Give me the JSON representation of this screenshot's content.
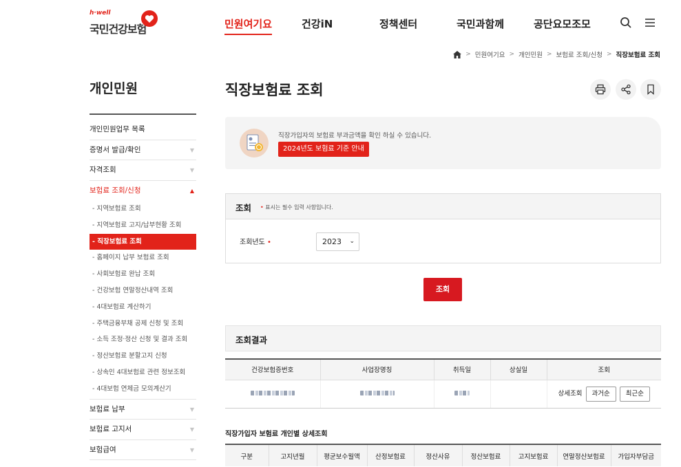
{
  "header": {
    "logo_small": "h·well",
    "logo_name": "국민건강보험",
    "nav": [
      {
        "label": "민원여기요",
        "active": true
      },
      {
        "label": "건강iN",
        "active": false
      },
      {
        "label": "정책센터",
        "active": false
      },
      {
        "label": "국민과함께",
        "active": false
      },
      {
        "label": "공단요모조모",
        "active": false
      }
    ],
    "icons": [
      "search-icon",
      "menu-icon"
    ]
  },
  "breadcrumb": {
    "home_icon": "home-icon",
    "items": [
      "민원여기요",
      "개인민원",
      "보험료 조회/신청"
    ],
    "current": "직장보험료 조회"
  },
  "sidebar": {
    "title": "개인민원",
    "items": [
      {
        "label": "개인민원업무 목록",
        "has_arrow": false
      },
      {
        "label": "증명서 발급/확인",
        "has_arrow": true
      },
      {
        "label": "자격조회",
        "has_arrow": true
      },
      {
        "label": "보험료 조회/신청",
        "has_arrow": true,
        "open": true
      },
      {
        "label": "보험료 납부",
        "has_arrow": true
      },
      {
        "label": "보험료 고지서",
        "has_arrow": true
      },
      {
        "label": "보험급여",
        "has_arrow": true
      }
    ],
    "sub_items": [
      "지역보험료 조회",
      "지역보험료 고지/납부현황 조회",
      "직장보험료 조회",
      "홈페이지 납부 보험료 조회",
      "사회보험료 완납 조회",
      "건강보험 연말정산내역 조회",
      "4대보험료 계산하기",
      "주택금융부채 공제 신청 및 조회",
      "소득 조정·정산 신청 및 결과 조회",
      "정산보험료 분할고지 신청",
      "상속인 4대보험료 관련 정보조회",
      "4대보험 연체금 모의계산기"
    ],
    "active_sub": 2
  },
  "main": {
    "title": "직장보험료 조회",
    "tools": [
      "print-icon",
      "share-icon",
      "bookmark-icon"
    ],
    "info": {
      "text": "직장가입자의 보험료 부과금액을 확인 하실 수 있습니다.",
      "button": "2024년도 보험료 기준 안내"
    },
    "query": {
      "title": "조회",
      "note": "표시는 필수 입력 사항입니다.",
      "year_label": "조회년도",
      "year_value": "2023",
      "search_button": "조회"
    },
    "result": {
      "title": "조회결과",
      "columns": [
        "건강보험증번호",
        "사업장명칭",
        "취득일",
        "상실일",
        "조회"
      ],
      "row": {
        "detail_label": "상세조회",
        "btn_old": "과거순",
        "btn_new": "최근순"
      }
    },
    "detail": {
      "title": "직장가입자 보험료 개인별 상세조회",
      "columns": [
        "구분",
        "고지년월",
        "평균보수월액",
        "산정보험료",
        "정산사유",
        "정산보험료",
        "고지보험료",
        "연말정산보험료",
        "가입자부담금"
      ]
    }
  },
  "colors": {
    "accent": "#e2231a",
    "button_red": "#d71920",
    "panel_bg": "#f4f4f4"
  }
}
